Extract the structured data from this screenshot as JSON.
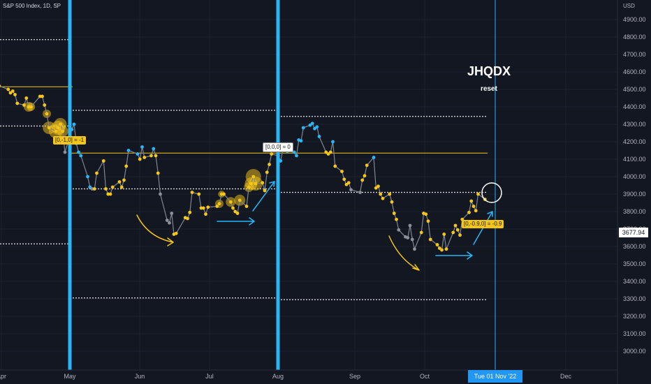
{
  "header": {
    "symbol": "S&P 500 Index, 1D, SP",
    "currency": "USD"
  },
  "indicator": {
    "title": "JHQDX",
    "reset_label": "reset"
  },
  "current_price_label": "3677.94",
  "crosshair_date_label": "Tue 01 Nov '22",
  "notes": [
    "[0,-1,0] = -1",
    "[0,0,0] = 0",
    "[0,-0.9,0] = -0.9"
  ],
  "colors": {
    "background": "#131722",
    "gold": "#f5c518",
    "blue": "#29b6f6",
    "grey": "#8a8f99",
    "axis_text": "#b2b5be"
  },
  "chart_data": {
    "type": "line",
    "ylim": [
      2900,
      5000
    ],
    "y_ticks": [
      3000,
      3100,
      3200,
      3300,
      3400,
      3500,
      3600,
      3700,
      3800,
      3900,
      4000,
      4100,
      4200,
      4300,
      4400,
      4500,
      4600,
      4700,
      4800,
      4900
    ],
    "x_tick_labels": [
      "Apr",
      "May",
      "Jun",
      "Jul",
      "Aug",
      "Sep",
      "Oct",
      "Dec"
    ],
    "series": [
      {
        "points": [
          {
            "x": "2022-03-29",
            "y": 4570,
            "c": "blue"
          },
          {
            "x": "2022-03-30",
            "y": 4590,
            "c": "blue"
          },
          {
            "x": "2022-03-31",
            "y": 4520,
            "c": "gold"
          },
          {
            "x": "2022-04-04",
            "y": 4500,
            "c": "gold"
          },
          {
            "x": "2022-04-05",
            "y": 4480,
            "c": "gold"
          },
          {
            "x": "2022-04-06",
            "y": 4490,
            "c": "gold"
          },
          {
            "x": "2022-04-07",
            "y": 4470,
            "c": "gold"
          },
          {
            "x": "2022-04-08",
            "y": 4420,
            "c": "gold"
          },
          {
            "x": "2022-04-11",
            "y": 4410,
            "c": "gold"
          },
          {
            "x": "2022-04-12",
            "y": 4450,
            "c": "gold"
          },
          {
            "x": "2022-04-13",
            "y": 4400,
            "c": "gold"
          },
          {
            "x": "2022-04-14",
            "y": 4400,
            "c": "gold"
          },
          {
            "x": "2022-04-18",
            "y": 4460,
            "c": "gold"
          },
          {
            "x": "2022-04-19",
            "y": 4460,
            "c": "gold"
          },
          {
            "x": "2022-04-20",
            "y": 4410,
            "c": "gold"
          },
          {
            "x": "2022-04-21",
            "y": 4360,
            "c": "gold"
          },
          {
            "x": "2022-04-22",
            "y": 4280,
            "c": "gold"
          },
          {
            "x": "2022-04-25",
            "y": 4260,
            "c": "gold"
          },
          {
            "x": "2022-04-26",
            "y": 4280,
            "c": "gold"
          },
          {
            "x": "2022-04-27",
            "y": 4300,
            "c": "gold"
          },
          {
            "x": "2022-04-28",
            "y": 4260,
            "c": "gold"
          },
          {
            "x": "2022-04-29",
            "y": 4140,
            "c": "grey"
          },
          {
            "x": "2022-05-02",
            "y": 4270,
            "c": "blue"
          },
          {
            "x": "2022-05-03",
            "y": 4300,
            "c": "blue"
          },
          {
            "x": "2022-05-04",
            "y": 4190,
            "c": "blue"
          },
          {
            "x": "2022-05-05",
            "y": 4140,
            "c": "blue"
          },
          {
            "x": "2022-05-06",
            "y": 4120,
            "c": "blue"
          },
          {
            "x": "2022-05-09",
            "y": 4000,
            "c": "blue"
          },
          {
            "x": "2022-05-10",
            "y": 3940,
            "c": "blue"
          },
          {
            "x": "2022-05-11",
            "y": 3930,
            "c": "grey"
          },
          {
            "x": "2022-05-12",
            "y": 3930,
            "c": "gold"
          },
          {
            "x": "2022-05-13",
            "y": 4020,
            "c": "gold"
          },
          {
            "x": "2022-05-16",
            "y": 4090,
            "c": "gold"
          },
          {
            "x": "2022-05-17",
            "y": 3930,
            "c": "gold"
          },
          {
            "x": "2022-05-18",
            "y": 3900,
            "c": "gold"
          },
          {
            "x": "2022-05-19",
            "y": 3900,
            "c": "gold"
          },
          {
            "x": "2022-05-20",
            "y": 3940,
            "c": "gold"
          },
          {
            "x": "2022-05-23",
            "y": 3970,
            "c": "gold"
          },
          {
            "x": "2022-05-24",
            "y": 3940,
            "c": "gold"
          },
          {
            "x": "2022-05-25",
            "y": 3980,
            "c": "gold"
          },
          {
            "x": "2022-05-26",
            "y": 4060,
            "c": "gold"
          },
          {
            "x": "2022-05-27",
            "y": 4150,
            "c": "blue"
          },
          {
            "x": "2022-05-31",
            "y": 4130,
            "c": "blue"
          },
          {
            "x": "2022-06-01",
            "y": 4100,
            "c": "gold"
          },
          {
            "x": "2022-06-02",
            "y": 4170,
            "c": "blue"
          },
          {
            "x": "2022-06-03",
            "y": 4110,
            "c": "gold"
          },
          {
            "x": "2022-06-06",
            "y": 4120,
            "c": "gold"
          },
          {
            "x": "2022-06-07",
            "y": 4160,
            "c": "blue"
          },
          {
            "x": "2022-06-08",
            "y": 4120,
            "c": "gold"
          },
          {
            "x": "2022-06-09",
            "y": 4020,
            "c": "gold"
          },
          {
            "x": "2022-06-10",
            "y": 3900,
            "c": "grey"
          },
          {
            "x": "2022-06-13",
            "y": 3750,
            "c": "grey"
          },
          {
            "x": "2022-06-14",
            "y": 3735,
            "c": "grey"
          },
          {
            "x": "2022-06-15",
            "y": 3790,
            "c": "grey"
          },
          {
            "x": "2022-06-16",
            "y": 3670,
            "c": "gold"
          },
          {
            "x": "2022-06-17",
            "y": 3675,
            "c": "gold"
          },
          {
            "x": "2022-06-21",
            "y": 3765,
            "c": "gold"
          },
          {
            "x": "2022-06-22",
            "y": 3760,
            "c": "gold"
          },
          {
            "x": "2022-06-23",
            "y": 3795,
            "c": "gold"
          },
          {
            "x": "2022-06-24",
            "y": 3910,
            "c": "gold"
          },
          {
            "x": "2022-06-27",
            "y": 3900,
            "c": "gold"
          },
          {
            "x": "2022-06-28",
            "y": 3820,
            "c": "gold"
          },
          {
            "x": "2022-06-29",
            "y": 3820,
            "c": "gold"
          },
          {
            "x": "2022-06-30",
            "y": 3785,
            "c": "gold"
          },
          {
            "x": "2022-07-01",
            "y": 3825,
            "c": "gold"
          },
          {
            "x": "2022-07-05",
            "y": 3830,
            "c": "gold"
          },
          {
            "x": "2022-07-06",
            "y": 3845,
            "c": "gold"
          },
          {
            "x": "2022-07-07",
            "y": 3900,
            "c": "gold"
          },
          {
            "x": "2022-07-08",
            "y": 3900,
            "c": "gold"
          },
          {
            "x": "2022-07-11",
            "y": 3855,
            "c": "gold"
          },
          {
            "x": "2022-07-12",
            "y": 3820,
            "c": "gold"
          },
          {
            "x": "2022-07-13",
            "y": 3800,
            "c": "gold"
          },
          {
            "x": "2022-07-14",
            "y": 3790,
            "c": "gold"
          },
          {
            "x": "2022-07-15",
            "y": 3865,
            "c": "gold"
          },
          {
            "x": "2022-07-18",
            "y": 3830,
            "c": "gold"
          },
          {
            "x": "2022-07-19",
            "y": 3940,
            "c": "gold"
          },
          {
            "x": "2022-07-20",
            "y": 3960,
            "c": "gold"
          },
          {
            "x": "2022-07-21",
            "y": 4000,
            "c": "gold"
          },
          {
            "x": "2022-07-22",
            "y": 3960,
            "c": "gold"
          },
          {
            "x": "2022-07-25",
            "y": 3965,
            "c": "gold"
          },
          {
            "x": "2022-07-26",
            "y": 3920,
            "c": "gold"
          },
          {
            "x": "2022-07-27",
            "y": 4025,
            "c": "gold"
          },
          {
            "x": "2022-07-28",
            "y": 4070,
            "c": "gold"
          },
          {
            "x": "2022-07-29",
            "y": 4130,
            "c": "gold"
          },
          {
            "x": "2022-08-01",
            "y": 4120,
            "c": "grey"
          },
          {
            "x": "2022-08-02",
            "y": 4090,
            "c": "blue"
          },
          {
            "x": "2022-08-03",
            "y": 4155,
            "c": "blue"
          },
          {
            "x": "2022-08-04",
            "y": 4150,
            "c": "blue"
          },
          {
            "x": "2022-08-05",
            "y": 4145,
            "c": "blue"
          },
          {
            "x": "2022-08-08",
            "y": 4140,
            "c": "blue"
          },
          {
            "x": "2022-08-09",
            "y": 4120,
            "c": "blue"
          },
          {
            "x": "2022-08-10",
            "y": 4210,
            "c": "blue"
          },
          {
            "x": "2022-08-11",
            "y": 4205,
            "c": "blue"
          },
          {
            "x": "2022-08-12",
            "y": 4280,
            "c": "blue"
          },
          {
            "x": "2022-08-15",
            "y": 4295,
            "c": "blue"
          },
          {
            "x": "2022-08-16",
            "y": 4305,
            "c": "blue"
          },
          {
            "x": "2022-08-17",
            "y": 4275,
            "c": "blue"
          },
          {
            "x": "2022-08-18",
            "y": 4285,
            "c": "blue"
          },
          {
            "x": "2022-08-19",
            "y": 4230,
            "c": "blue"
          },
          {
            "x": "2022-08-22",
            "y": 4140,
            "c": "gold"
          },
          {
            "x": "2022-08-23",
            "y": 4130,
            "c": "gold"
          },
          {
            "x": "2022-08-24",
            "y": 4140,
            "c": "gold"
          },
          {
            "x": "2022-08-25",
            "y": 4200,
            "c": "blue"
          },
          {
            "x": "2022-08-26",
            "y": 4060,
            "c": "gold"
          },
          {
            "x": "2022-08-29",
            "y": 4030,
            "c": "gold"
          },
          {
            "x": "2022-08-30",
            "y": 3985,
            "c": "gold"
          },
          {
            "x": "2022-08-31",
            "y": 3955,
            "c": "gold"
          },
          {
            "x": "2022-09-01",
            "y": 3965,
            "c": "gold"
          },
          {
            "x": "2022-09-02",
            "y": 3925,
            "c": "grey"
          },
          {
            "x": "2022-09-06",
            "y": 3910,
            "c": "grey"
          },
          {
            "x": "2022-09-07",
            "y": 3980,
            "c": "gold"
          },
          {
            "x": "2022-09-08",
            "y": 4005,
            "c": "gold"
          },
          {
            "x": "2022-09-09",
            "y": 4065,
            "c": "gold"
          },
          {
            "x": "2022-09-12",
            "y": 4110,
            "c": "blue"
          },
          {
            "x": "2022-09-13",
            "y": 3935,
            "c": "gold"
          },
          {
            "x": "2022-09-14",
            "y": 3945,
            "c": "gold"
          },
          {
            "x": "2022-09-15",
            "y": 3900,
            "c": "gold"
          },
          {
            "x": "2022-09-16",
            "y": 3875,
            "c": "gold"
          },
          {
            "x": "2022-09-19",
            "y": 3900,
            "c": "gold"
          },
          {
            "x": "2022-09-20",
            "y": 3855,
            "c": "gold"
          },
          {
            "x": "2022-09-21",
            "y": 3790,
            "c": "gold"
          },
          {
            "x": "2022-09-22",
            "y": 3755,
            "c": "gold"
          },
          {
            "x": "2022-09-23",
            "y": 3695,
            "c": "grey"
          },
          {
            "x": "2022-09-26",
            "y": 3655,
            "c": "grey"
          },
          {
            "x": "2022-09-27",
            "y": 3650,
            "c": "grey"
          },
          {
            "x": "2022-09-28",
            "y": 3720,
            "c": "grey"
          },
          {
            "x": "2022-09-29",
            "y": 3640,
            "c": "grey"
          },
          {
            "x": "2022-09-30",
            "y": 3585,
            "c": "grey"
          },
          {
            "x": "2022-10-03",
            "y": 3680,
            "c": "gold"
          },
          {
            "x": "2022-10-04",
            "y": 3790,
            "c": "gold"
          },
          {
            "x": "2022-10-05",
            "y": 3785,
            "c": "gold"
          },
          {
            "x": "2022-10-06",
            "y": 3745,
            "c": "gold"
          },
          {
            "x": "2022-10-07",
            "y": 3640,
            "c": "gold"
          },
          {
            "x": "2022-10-10",
            "y": 3610,
            "c": "gold"
          },
          {
            "x": "2022-10-11",
            "y": 3590,
            "c": "gold"
          },
          {
            "x": "2022-10-12",
            "y": 3580,
            "c": "gold"
          },
          {
            "x": "2022-10-13",
            "y": 3670,
            "c": "gold"
          },
          {
            "x": "2022-10-14",
            "y": 3585,
            "c": "gold"
          },
          {
            "x": "2022-10-17",
            "y": 3680,
            "c": "gold"
          },
          {
            "x": "2022-10-18",
            "y": 3720,
            "c": "gold"
          },
          {
            "x": "2022-10-19",
            "y": 3695,
            "c": "gold"
          },
          {
            "x": "2022-10-20",
            "y": 3665,
            "c": "gold"
          },
          {
            "x": "2022-10-21",
            "y": 3755,
            "c": "gold"
          },
          {
            "x": "2022-10-24",
            "y": 3795,
            "c": "gold"
          },
          {
            "x": "2022-10-25",
            "y": 3860,
            "c": "gold"
          },
          {
            "x": "2022-10-26",
            "y": 3830,
            "c": "gold"
          },
          {
            "x": "2022-10-27",
            "y": 3805,
            "c": "gold"
          },
          {
            "x": "2022-10-28",
            "y": 3900,
            "c": "gold"
          },
          {
            "x": "2022-10-31",
            "y": 3870,
            "c": "gold"
          }
        ]
      }
    ]
  }
}
